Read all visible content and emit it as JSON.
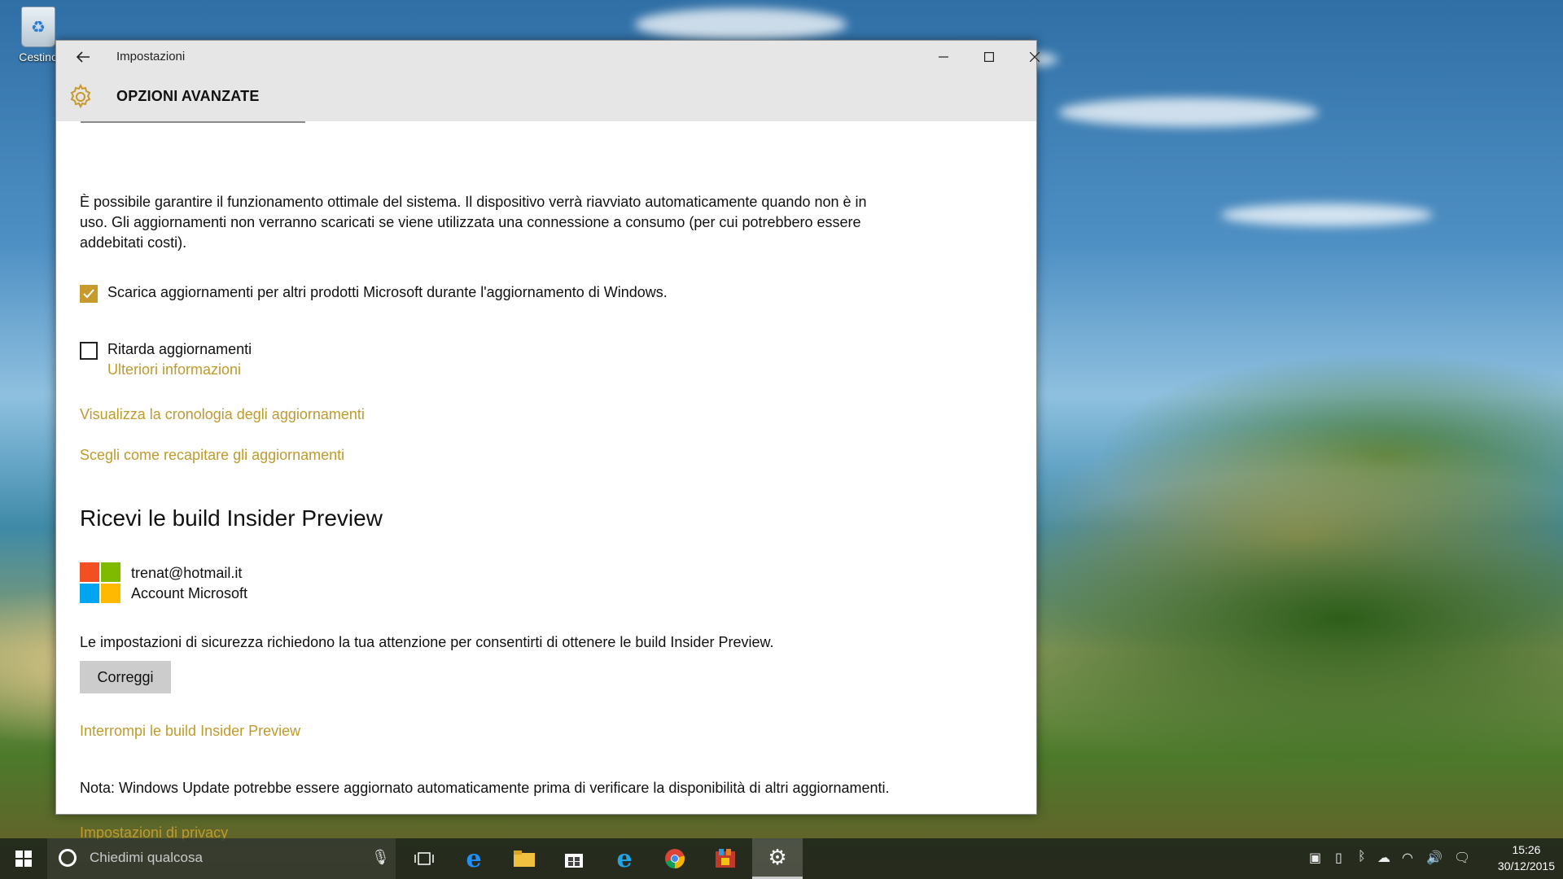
{
  "desktop": {
    "recycle_bin_label": "Cestino"
  },
  "window": {
    "app_title": "Impostazioni",
    "page_title": "OPZIONI AVANZATE",
    "accent_color": "#c09a2b"
  },
  "content": {
    "intro_text": "È possibile garantire il funzionamento ottimale del sistema. Il dispositivo verrà riavviato automaticamente quando non è in uso. Gli aggiornamenti non verranno scaricati se viene utilizzata una connessione a consumo (per cui potrebbero essere addebitati costi).",
    "checkbox_other_products": {
      "label": "Scarica aggiornamenti per altri prodotti Microsoft durante l'aggiornamento di Windows.",
      "checked": true
    },
    "checkbox_defer": {
      "label": "Ritarda aggiornamenti",
      "checked": false
    },
    "more_info_link": "Ulteriori informazioni",
    "history_link": "Visualizza la cronologia degli aggiornamenti",
    "delivery_link": "Scegli come recapitare gli aggiornamenti",
    "insider_title": "Ricevi le build Insider Preview",
    "account_email": "trenat@hotmail.it",
    "account_type": "Account Microsoft",
    "security_text": "Le impostazioni di sicurezza richiedono la tua attenzione per consentirti di ottenere le build Insider Preview.",
    "fix_button": "Correggi",
    "stop_insider_link": "Interrompi le build Insider Preview",
    "note_text": "Nota: Windows Update potrebbe essere aggiornato automaticamente prima di verificare la disponibilità di altri aggiornamenti.",
    "privacy_link": "Impostazioni di privacy"
  },
  "taskbar": {
    "search_placeholder": "Chiedimi qualcosa",
    "time": "15:26",
    "date": "30/12/2015"
  }
}
